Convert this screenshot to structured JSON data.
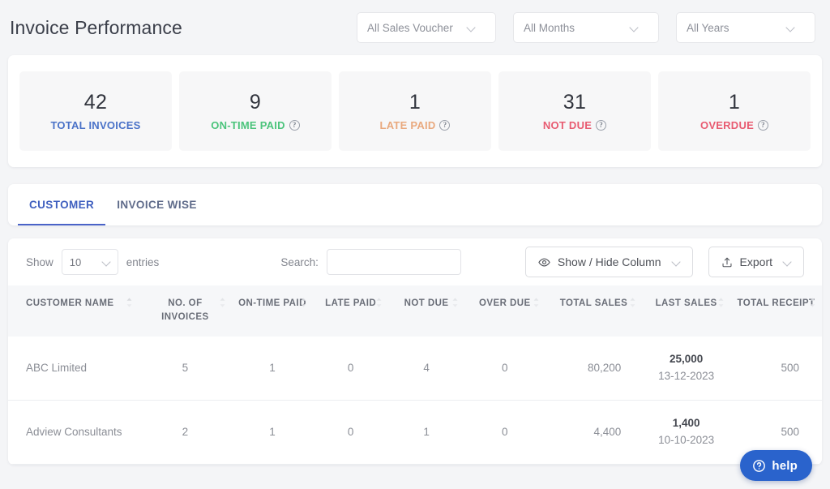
{
  "header": {
    "title": "Invoice Performance",
    "filters": [
      {
        "label": "All Sales Voucher",
        "icon": "chevron-down-icon"
      },
      {
        "label": "All Months",
        "icon": "chevron-down-icon"
      },
      {
        "label": "All Years",
        "icon": "chevron-down-icon"
      }
    ]
  },
  "stats": [
    {
      "value": "42",
      "label": "TOTAL INVOICES",
      "color": "#4a72c8",
      "help": false
    },
    {
      "value": "9",
      "label": "ON-TIME PAID",
      "color": "#4cc47c",
      "help": true
    },
    {
      "value": "1",
      "label": "LATE PAID",
      "color": "#e9a97e",
      "help": true
    },
    {
      "value": "31",
      "label": "NOT DUE",
      "color": "#e85b71",
      "help": true
    },
    {
      "value": "1",
      "label": "OVERDUE",
      "color": "#e85b71",
      "help": true
    }
  ],
  "tabs": [
    {
      "label": "CUSTOMER",
      "active": true
    },
    {
      "label": "INVOICE WISE",
      "active": false
    }
  ],
  "table_controls": {
    "show_label": "Show",
    "entries_value": "10",
    "entries_label": "entries",
    "search_label": "Search:",
    "search_value": "",
    "search_placeholder": "",
    "show_hide_column": "Show / Hide Column",
    "export": "Export"
  },
  "table": {
    "columns": [
      "CUSTOMER NAME",
      "NO. OF INVOICES",
      "ON-TIME PAID",
      "LATE PAID",
      "NOT DUE",
      "OVER DUE",
      "TOTAL SALES",
      "LAST SALES",
      "TOTAL RECEIPT"
    ],
    "rows": [
      {
        "customer_name": "ABC Limited",
        "no_of_invoices": "5",
        "on_time_paid": "1",
        "late_paid": "0",
        "not_due": "4",
        "over_due": "0",
        "total_sales": "80,200",
        "last_sales_amount": "25,000",
        "last_sales_date": "13-12-2023",
        "total_receipt": "500"
      },
      {
        "customer_name": "Adview Consultants",
        "no_of_invoices": "2",
        "on_time_paid": "1",
        "late_paid": "0",
        "not_due": "1",
        "over_due": "0",
        "total_sales": "4,400",
        "last_sales_amount": "1,400",
        "last_sales_date": "10-10-2023",
        "total_receipt": "500"
      }
    ]
  },
  "help_widget": {
    "label": "help",
    "color": "#2a63cc"
  }
}
